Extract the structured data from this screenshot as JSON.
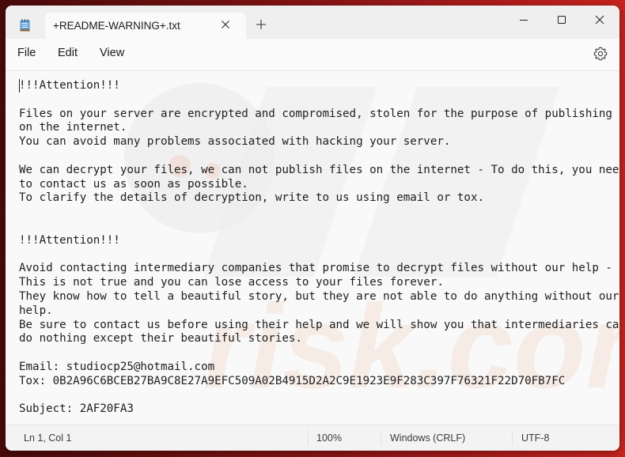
{
  "window": {
    "app_icon": "notepad-icon",
    "tabs": [
      {
        "title": "+README-WARNING+.txt",
        "active": true,
        "close_icon": "close-icon"
      }
    ],
    "new_tab_icon": "plus-icon",
    "controls": {
      "minimize_icon": "minimize-icon",
      "maximize_icon": "maximize-icon",
      "close_icon": "close-icon"
    }
  },
  "menu": {
    "items": [
      {
        "label": "File"
      },
      {
        "label": "Edit"
      },
      {
        "label": "View"
      }
    ],
    "settings_icon": "gear-icon"
  },
  "document": {
    "lines": [
      "!!!Attention!!!",
      "",
      "Files on your server are encrypted and compromised, stolen for the purpose of publishing",
      "on the internet.",
      "You can avoid many problems associated with hacking your server.",
      "",
      "We can decrypt your files, we can not publish files on the internet - To do this, you need",
      "to contact us as soon as possible.",
      "To clarify the details of decryption, write to us using email or tox.",
      "",
      "",
      "!!!Attention!!!",
      "",
      "Avoid contacting intermediary companies that promise to decrypt files without our help -",
      "This is not true and you can lose access to your files forever.",
      "They know how to tell a beautiful story, but they are not able to do anything without our",
      "help.",
      "Be sure to contact us before using their help and we will show you that intermediaries can",
      "do nothing except their beautiful stories.",
      "",
      "Email: studiocp25@hotmail.com",
      "Tox: 0B2A96C6BCEB27BA9C8E27A9EFC509A02B4915D2A2C9E1923E9F283C397F76321F22D70FB7FC",
      "",
      "Subject: 2AF20FA3"
    ],
    "email": "studiocp25@hotmail.com",
    "tox": "0B2A96C6BCEB27BA9C8E27A9EFC509A02B4915D2A2C9E1923E9F283C397F76321F22D70FB7FC",
    "subject": "2AF20FA3"
  },
  "status": {
    "position": "Ln 1, Col 1",
    "zoom": "100%",
    "line_ending": "Windows (CRLF)",
    "encoding": "UTF-8"
  },
  "colors": {
    "desktop_accent": "#b01c1c",
    "window_bg": "#f9f9f9",
    "titlebar_bg": "#efefef",
    "text": "#1e1e1e"
  }
}
